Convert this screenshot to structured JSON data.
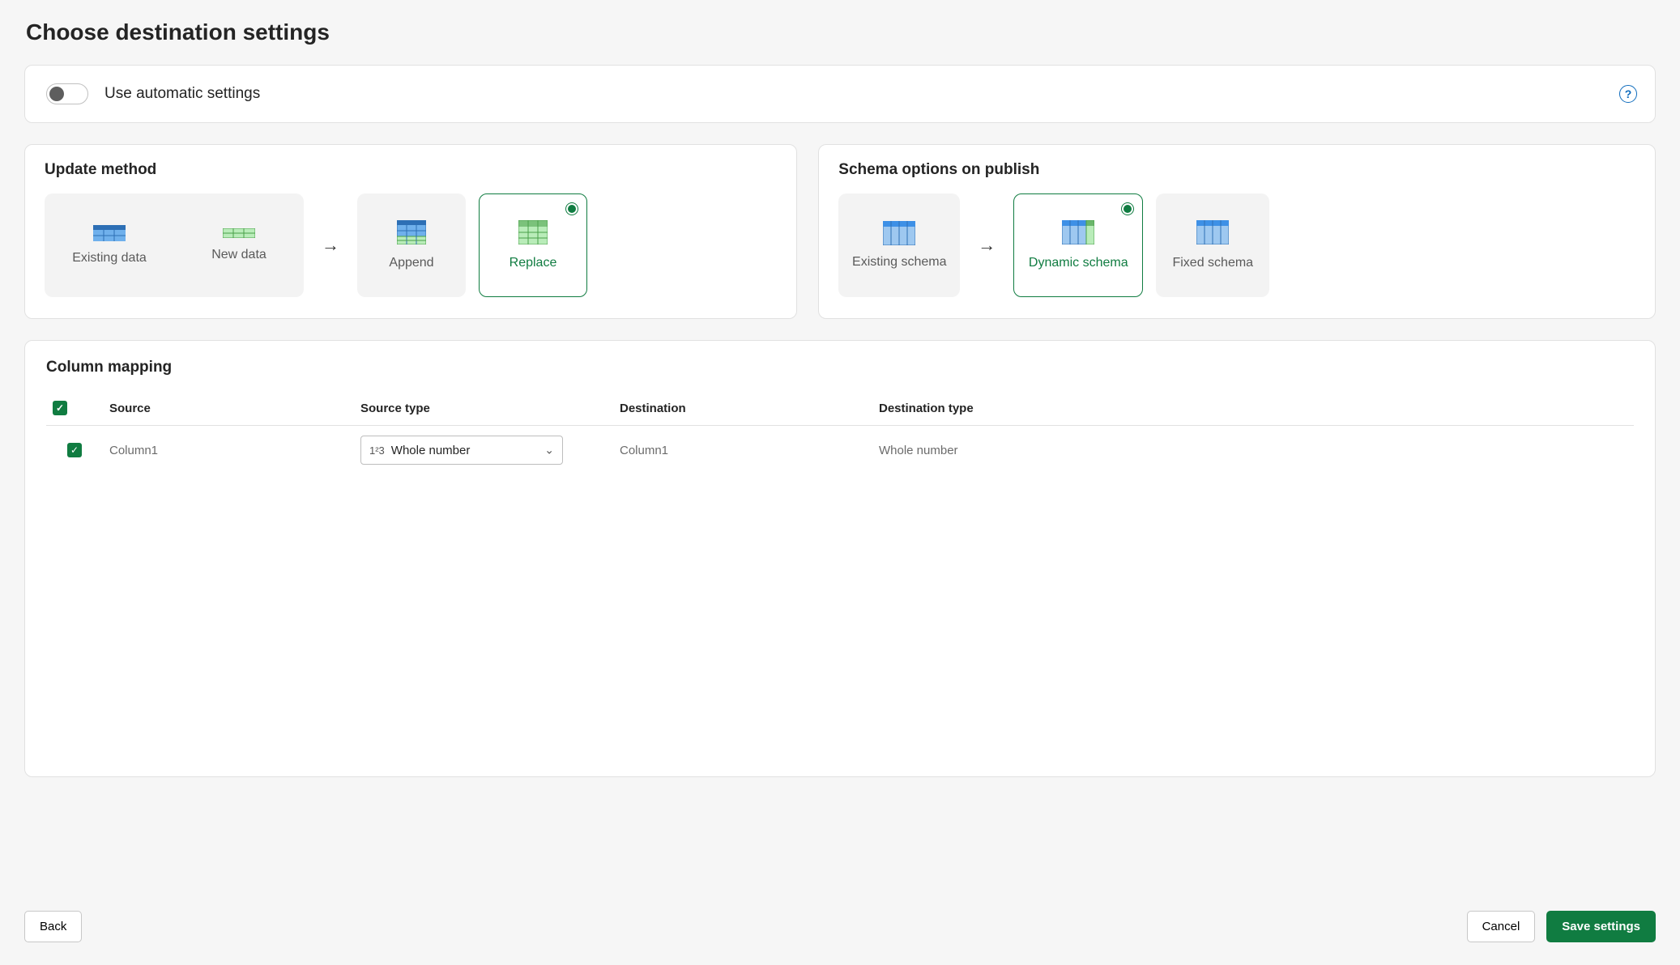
{
  "page": {
    "title": "Choose destination settings"
  },
  "auto": {
    "label": "Use automatic settings",
    "on": false
  },
  "update_method": {
    "title": "Update method",
    "existing": "Existing data",
    "newdata": "New data",
    "append": "Append",
    "replace": "Replace",
    "selected": "Replace"
  },
  "schema_options": {
    "title": "Schema options on publish",
    "existing": "Existing schema",
    "dynamic": "Dynamic schema",
    "fixed": "Fixed schema",
    "selected": "Dynamic schema"
  },
  "mapping": {
    "title": "Column mapping",
    "headers": {
      "source": "Source",
      "source_type": "Source type",
      "destination": "Destination",
      "destination_type": "Destination type"
    },
    "rows": [
      {
        "checked": true,
        "source": "Column1",
        "source_type": "Whole number",
        "destination": "Column1",
        "destination_type": "Whole number"
      }
    ]
  },
  "buttons": {
    "back": "Back",
    "cancel": "Cancel",
    "save": "Save settings"
  }
}
